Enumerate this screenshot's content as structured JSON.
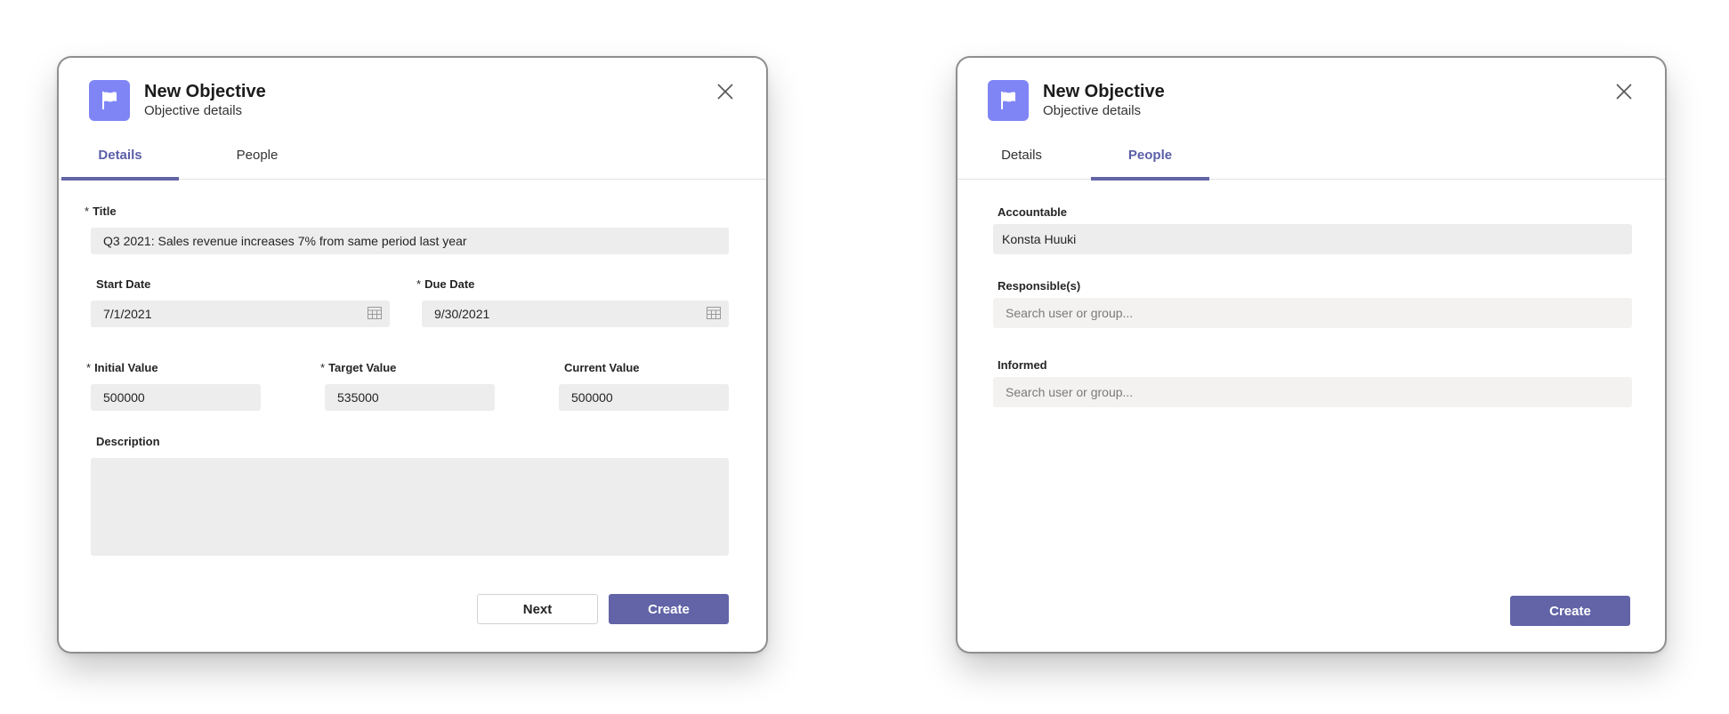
{
  "details_dialog": {
    "title": "New Objective",
    "subtitle": "Objective details",
    "tabs": [
      {
        "label": "Details",
        "active": true
      },
      {
        "label": "People",
        "active": false
      }
    ],
    "form": {
      "title_label": "Title",
      "title_value": "Q3 2021: Sales revenue increases 7% from same period last year",
      "start_date_label": "Start Date",
      "start_date_value": "7/1/2021",
      "due_date_label": "Due Date",
      "due_date_value": "9/30/2021",
      "initial_value_label": "Initial Value",
      "initial_value": "500000",
      "target_value_label": "Target Value",
      "target_value": "535000",
      "current_value_label": "Current Value",
      "current_value": "500000",
      "description_label": "Description",
      "description_value": ""
    },
    "required_mark": "*",
    "buttons": {
      "next": "Next",
      "create": "Create"
    }
  },
  "people_dialog": {
    "title": "New Objective",
    "subtitle": "Objective details",
    "tabs": [
      {
        "label": "Details",
        "active": false
      },
      {
        "label": "People",
        "active": true
      }
    ],
    "form": {
      "accountable_label": "Accountable",
      "accountable_value": "Konsta Huuki",
      "responsible_label": "Responsible(s)",
      "responsible_placeholder": "Search user or group...",
      "informed_label": "Informed",
      "informed_placeholder": "Search user or group..."
    },
    "buttons": {
      "create": "Create"
    }
  },
  "colors": {
    "accent": "#6264a7",
    "icon_bg": "#7f85f5",
    "field_bg": "#ededed"
  },
  "icons": [
    "flag-icon",
    "close-icon",
    "calendar-icon"
  ]
}
